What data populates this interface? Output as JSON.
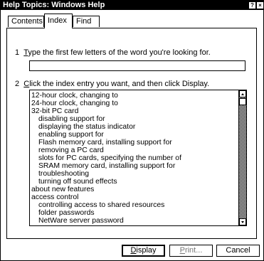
{
  "window": {
    "title": "Help Topics: Windows Help",
    "help_button": "?",
    "close_button": "×"
  },
  "tabs": [
    {
      "label": "Contents",
      "active": false
    },
    {
      "label": "Index",
      "active": true
    },
    {
      "label": "Find",
      "active": false
    }
  ],
  "step1": {
    "number": "1",
    "accel": "T",
    "rest": "ype the first few letters of the word you're looking for."
  },
  "search": {
    "value": "",
    "placeholder": ""
  },
  "step2": {
    "number": "2",
    "accel": "C",
    "rest": "lick the index entry you want, and then click Display."
  },
  "index_list": {
    "items": [
      {
        "text": "12-hour clock, changing to",
        "indent": 0
      },
      {
        "text": "24-hour clock, changing to",
        "indent": 0
      },
      {
        "text": "32-bit PC card",
        "indent": 0
      },
      {
        "text": "disabling support for",
        "indent": 1
      },
      {
        "text": "displaying the status indicator",
        "indent": 1
      },
      {
        "text": "enabling support for",
        "indent": 1
      },
      {
        "text": "Flash memory card, installing support for",
        "indent": 1
      },
      {
        "text": "removing a PC card",
        "indent": 1
      },
      {
        "text": "slots for PC cards, specifying the number of",
        "indent": 1
      },
      {
        "text": "SRAM memory card, installing support for",
        "indent": 1
      },
      {
        "text": "troubleshooting",
        "indent": 1
      },
      {
        "text": "turning off sound effects",
        "indent": 1
      },
      {
        "text": "about new features",
        "indent": 0
      },
      {
        "text": "access control",
        "indent": 0
      },
      {
        "text": "controlling access to shared resources",
        "indent": 1
      },
      {
        "text": "folder passwords",
        "indent": 1
      },
      {
        "text": "NetWare server password",
        "indent": 1
      }
    ]
  },
  "buttons": {
    "display_accel": "D",
    "display_rest": "isplay",
    "print_accel": "P",
    "print_rest": "rint...",
    "cancel": "Cancel"
  }
}
